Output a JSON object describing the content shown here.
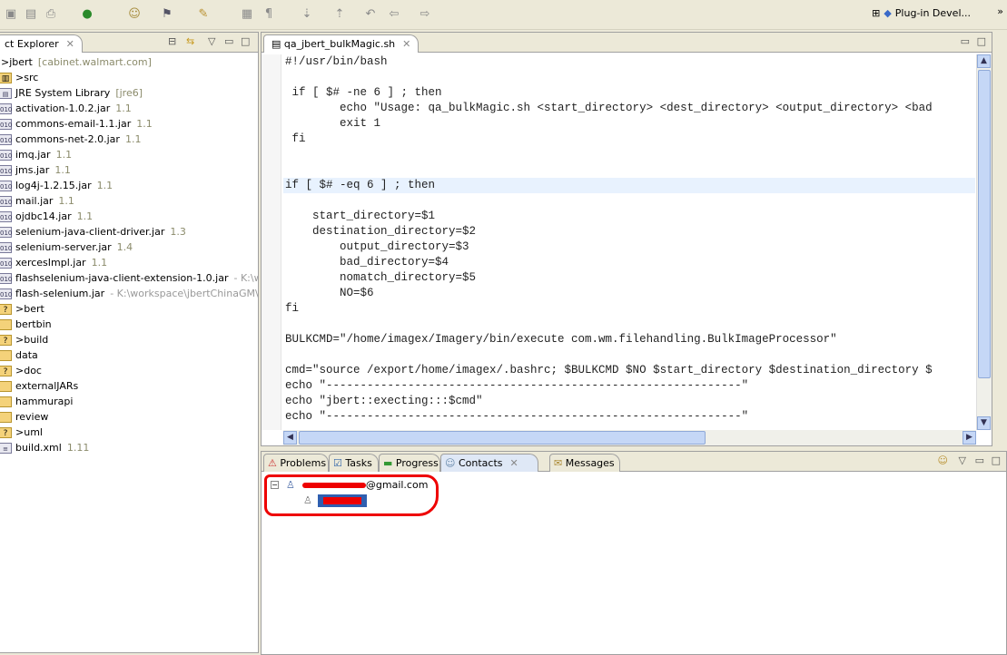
{
  "toolbar": {
    "perspective_label": "Plug-in Devel...",
    "overflow": "»"
  },
  "explorer": {
    "title": "ct Explorer",
    "items": [
      {
        "label": ">jbert",
        "extra": "[cabinet.walmart.com]",
        "icon": "project"
      },
      {
        "label": ">src",
        "extra": "",
        "icon": "package-folder"
      },
      {
        "label": "JRE System Library",
        "extra": "[jre6]",
        "icon": "library"
      },
      {
        "label": "activation-1.0.2.jar",
        "extra": "1.1",
        "icon": "jar"
      },
      {
        "label": "commons-email-1.1.jar",
        "extra": "1.1",
        "icon": "jar"
      },
      {
        "label": "commons-net-2.0.jar",
        "extra": "1.1",
        "icon": "jar"
      },
      {
        "label": "imq.jar",
        "extra": "1.1",
        "icon": "jar"
      },
      {
        "label": "jms.jar",
        "extra": "1.1",
        "icon": "jar"
      },
      {
        "label": "log4j-1.2.15.jar",
        "extra": "1.1",
        "icon": "jar"
      },
      {
        "label": "mail.jar",
        "extra": "1.1",
        "icon": "jar"
      },
      {
        "label": "ojdbc14.jar",
        "extra": "1.1",
        "icon": "jar"
      },
      {
        "label": "selenium-java-client-driver.jar",
        "extra": "1.3",
        "icon": "jar"
      },
      {
        "label": "selenium-server.jar",
        "extra": "1.4",
        "icon": "jar"
      },
      {
        "label": "xercesImpl.jar",
        "extra": "1.1",
        "icon": "jar"
      },
      {
        "label": "flashselenium-java-client-extension-1.0.jar",
        "extra": "- K:\\worksp",
        "icon": "jar"
      },
      {
        "label": "flash-selenium.jar",
        "extra": "- K:\\workspace\\jbertChinaGM\\extern",
        "icon": "jar"
      },
      {
        "label": ">bert",
        "extra": "",
        "icon": "folder-unknown"
      },
      {
        "label": "bertbin",
        "extra": "",
        "icon": "folder"
      },
      {
        "label": ">build",
        "extra": "",
        "icon": "folder-unknown"
      },
      {
        "label": "data",
        "extra": "",
        "icon": "folder"
      },
      {
        "label": ">doc",
        "extra": "",
        "icon": "folder-unknown"
      },
      {
        "label": "externalJARs",
        "extra": "",
        "icon": "folder"
      },
      {
        "label": "hammurapi",
        "extra": "",
        "icon": "folder"
      },
      {
        "label": "review",
        "extra": "",
        "icon": "folder"
      },
      {
        "label": ">uml",
        "extra": "",
        "icon": "folder-unknown"
      },
      {
        "label": "build.xml",
        "extra": "1.11",
        "icon": "xml-file"
      }
    ]
  },
  "editor": {
    "tab": "qa_jbert_bulkMagic.sh",
    "lines": [
      "#!/usr/bin/bash",
      "",
      " if [ $# -ne 6 ] ; then",
      "        echo \"Usage: qa_bulkMagic.sh <start_directory> <dest_directory> <output_directory> <bad",
      "        exit 1",
      " fi",
      "",
      "",
      "if [ $# -eq 6 ] ; then",
      "",
      "    start_directory=$1",
      "    destination_directory=$2",
      "        output_directory=$3",
      "        bad_directory=$4",
      "        nomatch_directory=$5",
      "        NO=$6",
      "fi",
      "",
      "BULKCMD=\"/home/imagex/Imagery/bin/execute com.wm.filehandling.BulkImageProcessor\"",
      "",
      "cmd=\"source /export/home/imagex/.bashrc; $BULKCMD $NO $start_directory $destination_directory $",
      "echo \"-------------------------------------------------------------\"",
      "echo \"jbert::execting:::$cmd\"",
      "echo \"-------------------------------------------------------------\""
    ],
    "highlight_line": 8
  },
  "bottom": {
    "tabs": [
      "Problems",
      "Tasks",
      "Progress",
      "Contacts",
      "Messages"
    ],
    "active": "Contacts",
    "contacts": {
      "account": "@gmail.com"
    }
  }
}
